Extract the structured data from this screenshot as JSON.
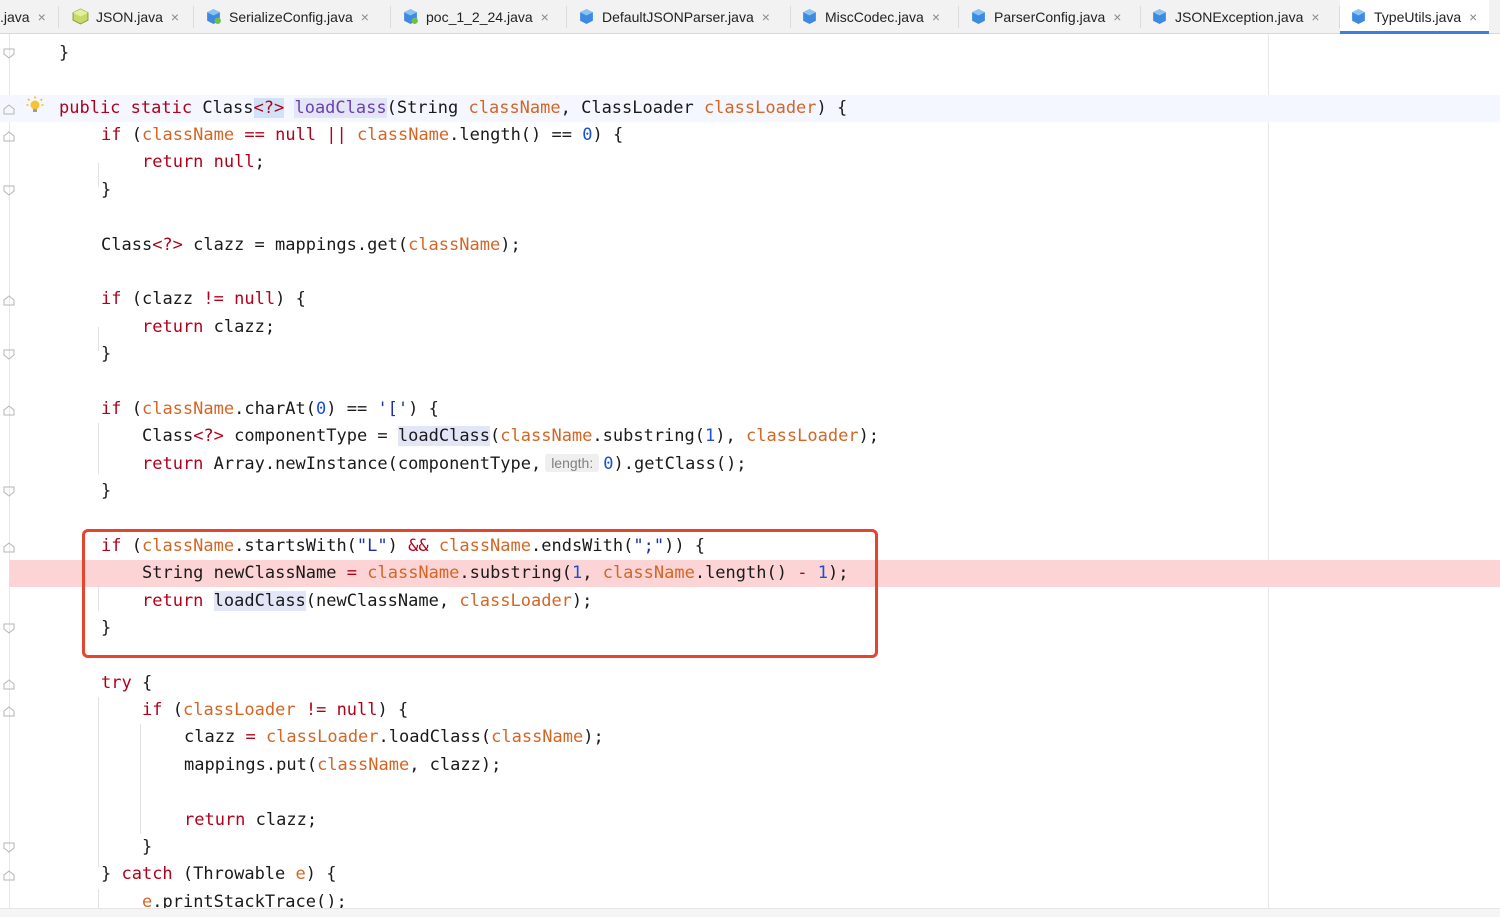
{
  "tabs": [
    {
      "label": ".java",
      "icon": "java-file-icon"
    },
    {
      "label": "JSON.java",
      "icon": "java-class-icon"
    },
    {
      "label": "SerializeConfig.java",
      "icon": "java-class-icon"
    },
    {
      "label": "poc_1_2_24.java",
      "icon": "java-class-icon"
    },
    {
      "label": "DefaultJSONParser.java",
      "icon": "java-class-icon"
    },
    {
      "label": "MiscCodec.java",
      "icon": "java-class-icon"
    },
    {
      "label": "ParserConfig.java",
      "icon": "java-class-icon"
    },
    {
      "label": "JSONException.java",
      "icon": "java-class-icon"
    },
    {
      "label": "TypeUtils.java",
      "icon": "java-class-icon",
      "active": true
    }
  ],
  "close_glyph": "×",
  "colors": {
    "keyword": "#b2001a",
    "variable": "#d36625",
    "number": "#1a4fd0",
    "method": "#6e3fb1",
    "breakpoint_line": "#fdd4d5",
    "highlight_box": "#e5452d",
    "active_tab_underline": "#3d7ee0"
  },
  "code": {
    "l0": "}",
    "l2_kw": "public static",
    "l2_type": "Class",
    "l2_gen": "<?>",
    "l2_fn": "loadClass",
    "l2_p1": "(String",
    "l2_cn": "className",
    "l2_p2": ", ClassLoader",
    "l2_cl": "classLoader",
    "l2_end": ") {",
    "if": "if",
    "return": "return",
    "null": "null",
    "try": "try",
    "catch": "catch",
    "className": "className",
    "classLoader": "classLoader",
    "l3_a": "(",
    "l3_b": "==",
    "l3_c": "||",
    "l3_d": ".length() ==",
    "l3_e": "0",
    "l3_f": ") {",
    "semi": ";",
    "brace_close": "}",
    "l7_a": "Class",
    "l7_b": "<?>",
    "l7_c": " clazz = mappings.get(",
    "l7_d": ");",
    "l9_a": "(clazz",
    "l9_b": "!=",
    "l9_c": ") {",
    "l10": "clazz;",
    "l13_a": ".charAt(",
    "l13_b": "0",
    "l13_c": ") ==",
    "l13_d": "'['",
    "l13_e": ") {",
    "l14_a": "Class",
    "l14_b": "<?>",
    "l14_c": " componentType = ",
    "l14_fn": "loadClass",
    "l14_d": ".substring(",
    "l14_e": "1",
    "l14_f": "), ",
    "l14_g": ");",
    "l15_a": "Array.newInstance(componentType,",
    "l15_hint": "length:",
    "l15_b": "0",
    "l15_c": ").getClass();",
    "l18_a": ".startsWith(",
    "l18_b": "\"L\"",
    "l18_c": ")",
    "l18_d": "&&",
    "l18_e": ".endsWith(",
    "l18_f": "\";\"",
    "l18_g": ")) {",
    "l19_a": "String",
    "l19_b": "newClassName",
    "l19_c": "=",
    "l19_d": ".substring(",
    "l19_e": "1",
    "l19_f": ", ",
    "l19_g": ".length()",
    "l19_h": "-",
    "l19_i": "1",
    "l19_j": ");",
    "l20_fn": "loadClass",
    "l20_a": "(newClassName, ",
    "l20_b": ");",
    "l23_a": "{",
    "l24_a": "(",
    "l24_b": "!=",
    "l24_c": ") {",
    "l25_a": "clazz",
    "l25_b": "=",
    "l25_c": ".loadClass(",
    "l25_d": ");",
    "l26_a": "mappings.put(",
    "l26_b": ", clazz);",
    "l28": "clazz;",
    "l31_a": "} ",
    "l31_b": "(Throwable",
    "l31_c": "e",
    "l31_d": ") {",
    "l32_a": "e",
    "l32_b": ".printStackTrace();"
  }
}
